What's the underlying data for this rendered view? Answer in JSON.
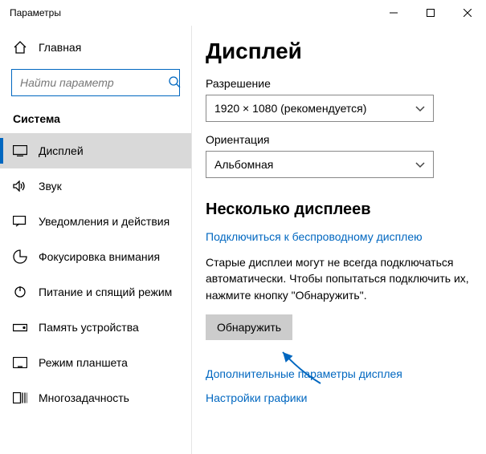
{
  "window": {
    "title": "Параметры"
  },
  "sidebar": {
    "home_label": "Главная",
    "search_placeholder": "Найти параметр",
    "section_label": "Система",
    "items": [
      {
        "label": "Дисплей"
      },
      {
        "label": "Звук"
      },
      {
        "label": "Уведомления и действия"
      },
      {
        "label": "Фокусировка внимания"
      },
      {
        "label": "Питание и спящий режим"
      },
      {
        "label": "Память устройства"
      },
      {
        "label": "Режим планшета"
      },
      {
        "label": "Многозадачность"
      }
    ]
  },
  "main": {
    "title": "Дисплей",
    "resolution_label": "Разрешение",
    "resolution_value": "1920 × 1080 (рекомендуется)",
    "orientation_label": "Ориентация",
    "orientation_value": "Альбомная",
    "multi_title": "Несколько дисплеев",
    "wireless_link": "Подключиться к беспроводному дисплею",
    "detect_desc": "Старые дисплеи могут не всегда подключаться автоматически. Чтобы попытаться подключить их, нажмите кнопку \"Обнаружить\".",
    "detect_btn": "Обнаружить",
    "advanced_link": "Дополнительные параметры дисплея",
    "graphics_link": "Настройки графики"
  }
}
